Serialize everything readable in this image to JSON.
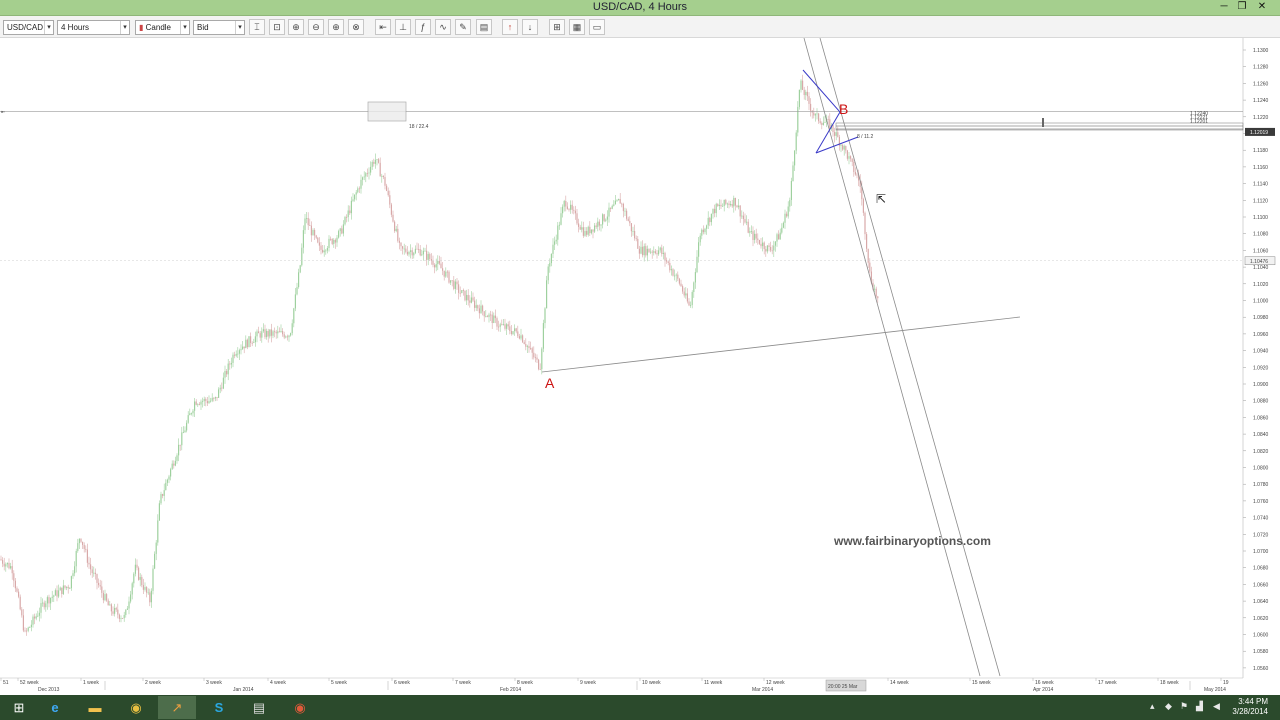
{
  "window": {
    "title": "USD/CAD, 4 Hours",
    "minimize": "─",
    "restore": "❐",
    "close": "✕"
  },
  "toolbar": {
    "symbol": "USD/CAD",
    "timeframe": "4 Hours",
    "chart_type": "Candle",
    "price_side": "Bid",
    "buttons": [
      "crosshair-icon",
      "lock-icon",
      "zoom-in-icon",
      "zoom-out-icon",
      "zoom-in-alt-icon",
      "zoom-reset-icon",
      "line-tool-icon",
      "vertical-line-icon",
      "fibonacci-icon",
      "pattern-icon",
      "tools-icon",
      "template-icon",
      "buy-arrow-icon",
      "sell-arrow-icon",
      "grid-icon",
      "layout-icon",
      "settings-icon"
    ]
  },
  "chart": {
    "price_labels": [
      "1.1300",
      "1.1280",
      "1.1260",
      "1.1240",
      "1.1220",
      "1.1200",
      "1.1180",
      "1.1160",
      "1.1140",
      "1.1120",
      "1.1100",
      "1.1080",
      "1.1060",
      "1.1040",
      "1.1020",
      "1.1000",
      "1.0980",
      "1.0960",
      "1.0940",
      "1.0920",
      "1.0900",
      "1.0880",
      "1.0860",
      "1.0840",
      "1.0820",
      "1.0800",
      "1.0780",
      "1.0760",
      "1.0740",
      "1.0720",
      "1.0700",
      "1.0680",
      "1.0660",
      "1.0640",
      "1.0620",
      "1.0600",
      "1.0580",
      "1.0560"
    ],
    "current_price": "1.10476",
    "marker_price": "1.12019",
    "week_labels": [
      "51",
      "52 week",
      "1 week",
      "2 week",
      "3 week",
      "4 week",
      "5 week",
      "6 week",
      "7 week",
      "8 week",
      "9 week",
      "10 week",
      "11 week",
      "12 week",
      "14 week",
      "15 week",
      "16 week",
      "17 week",
      "18 week",
      "19"
    ],
    "month_labels": [
      "Dec 2013",
      "Jan 2014",
      "Feb 2014",
      "Mar 2014",
      "Apr 2014",
      "May 2014"
    ],
    "cursor_time": "20:00 25 Mar",
    "box_label": "18 / 22.4",
    "triangle_label": "8 / 11.2",
    "label_A": "A",
    "label_B": "B",
    "fib_labels": [
      "1.12240",
      "1.12221",
      "1.12201"
    ],
    "colors": {
      "bull": "#9ed09e",
      "bear": "#d8a8a8",
      "annotation": "#cc1111",
      "triangle": "#3a3ac8"
    }
  },
  "watermark": "www.fairbinaryoptions.com",
  "taskbar": {
    "apps": [
      "windows-start-icon",
      "ie-icon",
      "file-explorer-icon",
      "chrome-icon",
      "trading-app-icon",
      "skype-icon",
      "document-icon",
      "chrome-alt-icon"
    ],
    "time": "3:44 PM",
    "date": "3/28/2014"
  }
}
